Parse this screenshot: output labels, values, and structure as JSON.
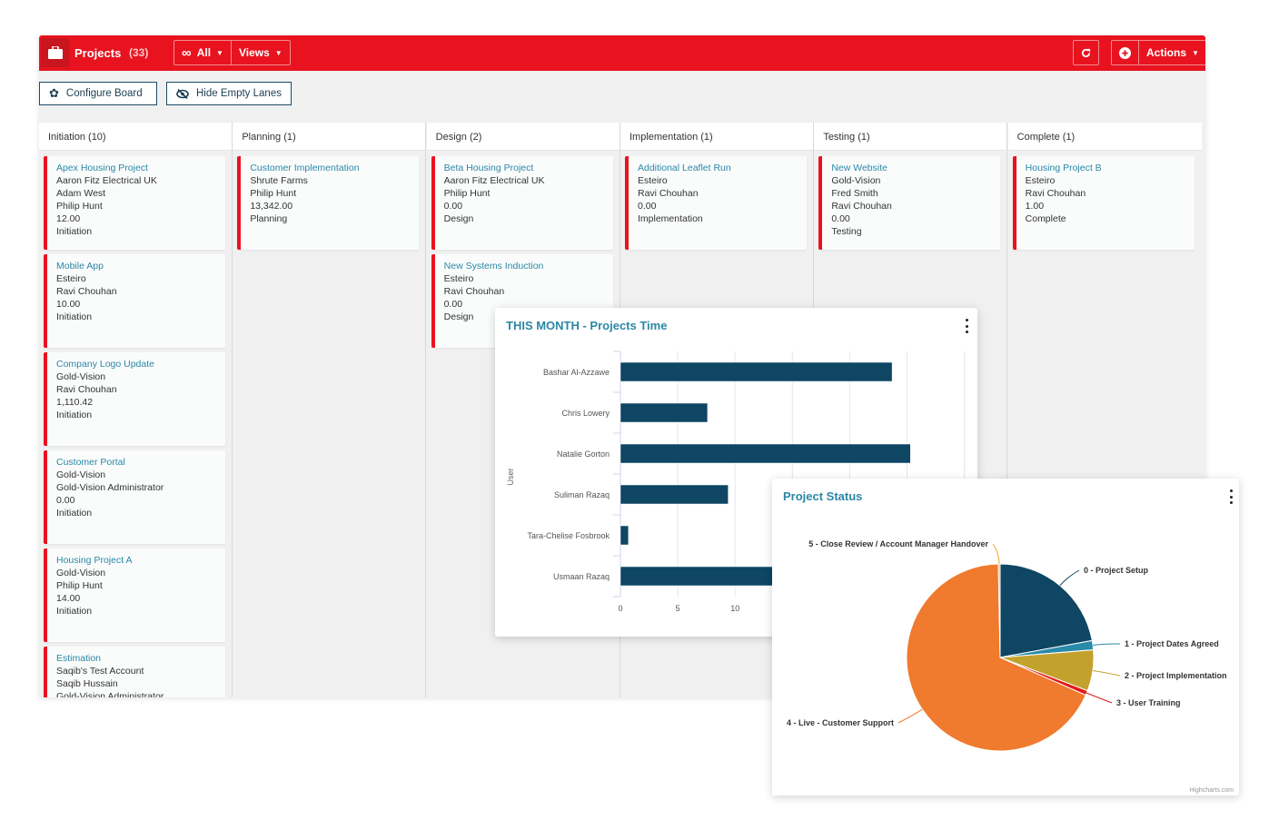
{
  "header": {
    "title": "Projects",
    "count": "(33)",
    "filter_label": "All",
    "views_label": "Views",
    "actions_label": "Actions",
    "brand_color": "#e8131f"
  },
  "toolbar": {
    "configure_board": "Configure Board",
    "hide_empty_lanes": "Hide Empty Lanes"
  },
  "lanes": [
    {
      "header": "Initiation (10)",
      "cards": [
        {
          "title": "Apex Housing Project",
          "lines": [
            "Aaron Fitz Electrical UK",
            "Adam West",
            "Philip Hunt",
            "12.00",
            "Initiation"
          ]
        },
        {
          "title": "Mobile App",
          "lines": [
            "Esteiro",
            "Ravi Chouhan",
            "10.00",
            "Initiation"
          ]
        },
        {
          "title": "Company Logo Update",
          "lines": [
            "Gold-Vision",
            "Ravi Chouhan",
            "1,110.42",
            "Initiation"
          ]
        },
        {
          "title": "Customer Portal",
          "lines": [
            "Gold-Vision",
            "Gold-Vision Administrator",
            "0.00",
            "Initiation"
          ]
        },
        {
          "title": "Housing Project A",
          "lines": [
            "Gold-Vision",
            "Philip Hunt",
            "14.00",
            "Initiation"
          ]
        },
        {
          "title": "Estimation",
          "lines": [
            "Saqib's Test Account",
            "Saqib Hussain",
            "Gold-Vision Administrator"
          ]
        }
      ]
    },
    {
      "header": "Planning (1)",
      "cards": [
        {
          "title": "Customer Implementation",
          "lines": [
            "Shrute Farms",
            "Philip Hunt",
            "13,342.00",
            "Planning"
          ]
        }
      ]
    },
    {
      "header": "Design (2)",
      "cards": [
        {
          "title": "Beta Housing Project",
          "lines": [
            "Aaron Fitz Electrical UK",
            "Philip Hunt",
            "0.00",
            "Design"
          ]
        },
        {
          "title": "New Systems Induction",
          "lines": [
            "Esteiro",
            "Ravi Chouhan",
            "0.00",
            "Design"
          ]
        }
      ]
    },
    {
      "header": "Implementation (1)",
      "cards": [
        {
          "title": "Additional Leaflet Run",
          "lines": [
            "Esteiro",
            "Ravi Chouhan",
            "0.00",
            "Implementation"
          ]
        }
      ]
    },
    {
      "header": "Testing (1)",
      "cards": [
        {
          "title": "New Website",
          "lines": [
            "Gold-Vision",
            "Fred Smith",
            "Ravi Chouhan",
            "0.00",
            "Testing"
          ]
        }
      ]
    },
    {
      "header": "Complete (1)",
      "cards": [
        {
          "title": "Housing Project B",
          "lines": [
            "Esteiro",
            "Ravi Chouhan",
            "1.00",
            "Complete"
          ]
        }
      ]
    }
  ],
  "chart_data": [
    {
      "type": "bar",
      "orientation": "horizontal",
      "title": "THIS MONTH - Projects Time",
      "xlabel": "",
      "ylabel": "User",
      "categories": [
        "Bashar Al-Azzawe",
        "Chris Lowery",
        "Natalie Gorton",
        "Suliman Razaq",
        "Tara-Chelise Fosbrook",
        "Usmaan Razaq"
      ],
      "values": [
        23.7,
        7.6,
        25.3,
        9.4,
        0.7,
        14
      ],
      "x_ticks": [
        "0",
        "5",
        "10"
      ],
      "xlim": [
        0,
        30
      ],
      "grid": true,
      "color": "#0e4664"
    },
    {
      "type": "pie",
      "title": "Project Status",
      "credits": "Highcharts.com",
      "slices": [
        {
          "label": "0 - Project Setup",
          "value": 22.1,
          "color": "#0e4664"
        },
        {
          "label": "1 - Project Dates Agreed",
          "value": 1.6,
          "color": "#2a8aa9"
        },
        {
          "label": "2 - Project Implementation",
          "value": 7.1,
          "color": "#c2a22c"
        },
        {
          "label": "3 - User Training",
          "value": 0.8,
          "color": "#e01a1a"
        },
        {
          "label": "4 - Live - Customer Support",
          "value": 68.1,
          "color": "#f07a2e"
        },
        {
          "label": "5 - Close Review / Account Manager Handover",
          "value": 0.3,
          "color": "#f2a93b"
        }
      ]
    }
  ]
}
